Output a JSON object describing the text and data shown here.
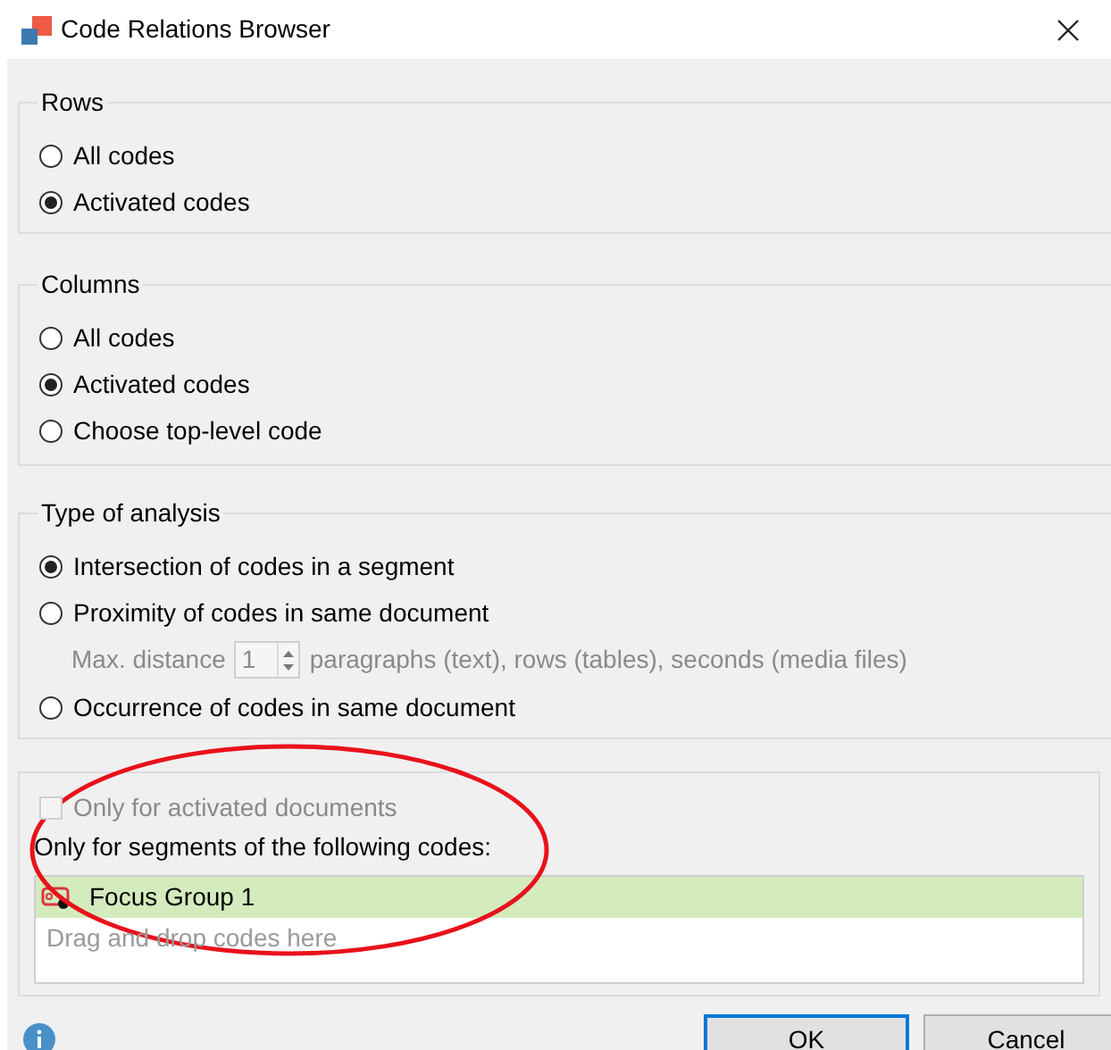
{
  "window": {
    "title": "Code Relations Browser"
  },
  "rows": {
    "title": "Rows",
    "options": [
      {
        "label": "All codes",
        "selected": false
      },
      {
        "label": "Activated codes",
        "selected": true
      }
    ]
  },
  "columns": {
    "title": "Columns",
    "options": [
      {
        "label": "All codes",
        "selected": false
      },
      {
        "label": "Activated codes",
        "selected": true
      },
      {
        "label": "Choose top-level code",
        "selected": false
      }
    ]
  },
  "analysis": {
    "title": "Type of analysis",
    "options": [
      {
        "label": "Intersection of codes in a segment",
        "selected": true
      },
      {
        "label": "Proximity of codes in same document",
        "selected": false
      },
      {
        "label": "Occurrence of codes in same document",
        "selected": false
      }
    ],
    "max_distance": {
      "label": "Max. distance",
      "value": "1",
      "unit": "paragraphs (text), rows (tables), seconds (media files)",
      "disabled": true
    }
  },
  "filter": {
    "activated_documents": {
      "label": "Only for activated documents",
      "checked": false,
      "disabled": true
    },
    "segments_label": "Only for segments of the following codes:",
    "codes": [
      {
        "name": "Focus Group 1",
        "selected": true
      }
    ],
    "placeholder": "Drag and drop codes here"
  },
  "buttons": [
    {
      "label": "OK",
      "default": true
    },
    {
      "label": "Cancel",
      "default": false
    }
  ]
}
